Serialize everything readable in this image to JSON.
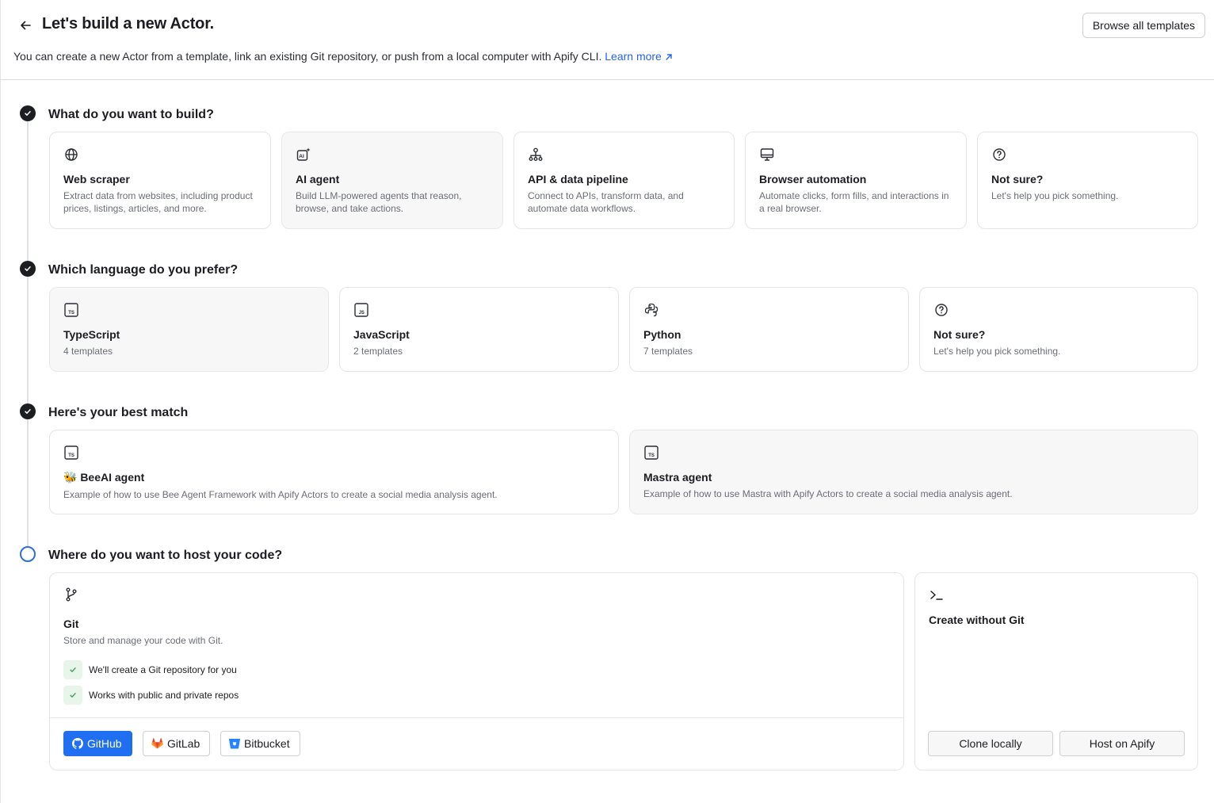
{
  "header": {
    "title": "Let's build a new Actor.",
    "subtitle": "You can create a new Actor from a template, link an existing Git repository, or push from a local computer with Apify CLI.",
    "learn_more": "Learn more",
    "browse_all": "Browse all templates"
  },
  "steps": {
    "build": {
      "title": "What do you want to build?",
      "options": [
        {
          "title": "Web scraper",
          "desc": "Extract data from websites, including product prices, listings, articles, and more.",
          "icon": "globe-icon"
        },
        {
          "title": "AI agent",
          "desc": "Build LLM-powered agents that reason, browse, and take actions.",
          "icon": "ai-sparkle-icon",
          "selected": true
        },
        {
          "title": "API & data pipeline",
          "desc": "Connect to APIs, transform data, and automate data workflows.",
          "icon": "network-icon"
        },
        {
          "title": "Browser automation",
          "desc": "Automate clicks, form fills, and interactions in a real browser.",
          "icon": "monitor-icon"
        },
        {
          "title": "Not sure?",
          "desc": "Let's help you pick something.",
          "icon": "help-circle-icon"
        }
      ]
    },
    "language": {
      "title": "Which language do you prefer?",
      "options": [
        {
          "title": "TypeScript",
          "desc": "4 templates",
          "icon": "typescript-icon",
          "selected": true
        },
        {
          "title": "JavaScript",
          "desc": "2 templates",
          "icon": "javascript-icon"
        },
        {
          "title": "Python",
          "desc": "7 templates",
          "icon": "python-icon"
        },
        {
          "title": "Not sure?",
          "desc": "Let's help you pick something.",
          "icon": "help-circle-icon"
        }
      ]
    },
    "match": {
      "title": "Here's your best match",
      "options": [
        {
          "title": "🐝 BeeAI agent",
          "desc": "Example of how to use Bee Agent Framework with Apify Actors to create a social media analysis agent.",
          "icon": "typescript-icon"
        },
        {
          "title": "Mastra agent",
          "desc": "Example of how to use Mastra with Apify Actors to create a social media analysis agent.",
          "icon": "typescript-icon",
          "selected": true
        }
      ]
    },
    "host": {
      "title": "Where do you want to host your code?",
      "git": {
        "title": "Git",
        "desc": "Store and manage your code with Git.",
        "checks": [
          "We'll create a Git repository for you",
          "Works with public and private repos"
        ],
        "providers": [
          "GitHub",
          "GitLab",
          "Bitbucket"
        ]
      },
      "no_git": {
        "title": "Create without Git",
        "clone": "Clone locally",
        "host_apify": "Host on Apify"
      }
    }
  },
  "colors": {
    "accent": "#1f6ff0",
    "link": "#2563eb",
    "check_bg": "#e8f5ea",
    "check": "#3aa55a"
  }
}
